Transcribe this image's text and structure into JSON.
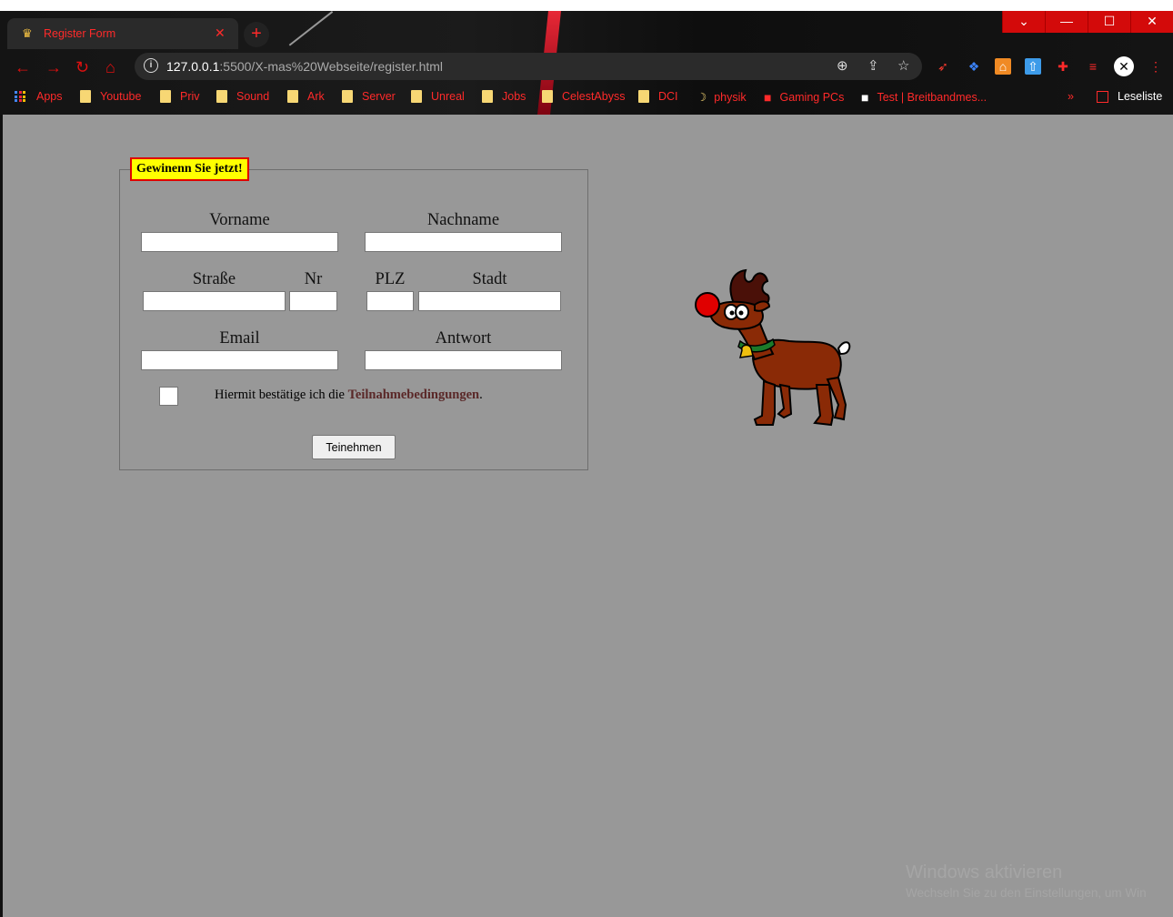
{
  "tab": {
    "title": "Register Form",
    "favicon": "crown-icon"
  },
  "window_controls": {
    "chevron": "⌄",
    "minimize": "—",
    "maximize": "☐",
    "close": "✕"
  },
  "address_bar": {
    "host": "127.0.0.1",
    "path": ":5500/X-mas%20Webseite/register.html"
  },
  "bookmarks": [
    {
      "label": "Apps",
      "icon": "apps-icon"
    },
    {
      "label": "Youtube",
      "icon": "folder-icon"
    },
    {
      "label": "Priv",
      "icon": "folder-icon"
    },
    {
      "label": "Sound",
      "icon": "folder-icon"
    },
    {
      "label": "Ark",
      "icon": "folder-icon"
    },
    {
      "label": "Server",
      "icon": "folder-icon"
    },
    {
      "label": "Unreal",
      "icon": "folder-icon"
    },
    {
      "label": "Jobs",
      "icon": "folder-icon"
    },
    {
      "label": "CelestAbyss",
      "icon": "folder-icon"
    },
    {
      "label": "DCI",
      "icon": "folder-icon"
    },
    {
      "label": "physik",
      "icon": "moon-icon"
    },
    {
      "label": "Gaming PCs",
      "icon": "site-icon"
    },
    {
      "label": "Test | Breitbandmes...",
      "icon": "site-icon"
    }
  ],
  "bookmarks_more": "»",
  "reading_list": "Leseliste",
  "form": {
    "legend": "Gewinenn Sie jetzt!",
    "labels": {
      "vorname": "Vorname",
      "nachname": "Nachname",
      "strasse": "Straße",
      "nr": "Nr",
      "plz": "PLZ",
      "stadt": "Stadt",
      "email": "Email",
      "antwort": "Antwort"
    },
    "agree_prefix": "Hiermit bestätige ich die ",
    "agree_link": "Teilnahmebedingungen",
    "agree_suffix": ".",
    "submit": "Teinehmen"
  },
  "watermark": {
    "title": "Windows aktivieren",
    "subtitle": "Wechseln Sie zu den Einstellungen, um Win"
  },
  "colors": {
    "page_bg": "#989898",
    "accent_red": "#ff2a2a",
    "legend_bg": "#ffff00",
    "legend_border": "#e00000"
  }
}
